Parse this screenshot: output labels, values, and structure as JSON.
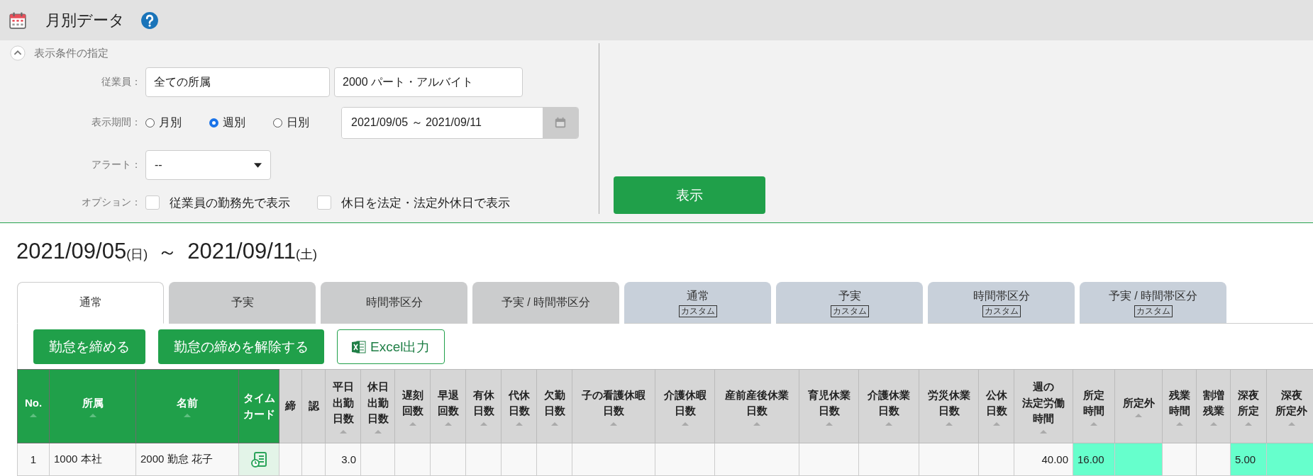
{
  "header": {
    "title": "月別データ"
  },
  "conditions": {
    "section_title": "表示条件の指定",
    "expanded": true,
    "employee": {
      "label": "従業員：",
      "department": "全ての所属",
      "employment_type": "2000 パート・アルバイト"
    },
    "period": {
      "label": "表示期間：",
      "options": [
        {
          "label": "月別",
          "selected": false
        },
        {
          "label": "週別",
          "selected": true
        },
        {
          "label": "日別",
          "selected": false
        }
      ],
      "range": "2021/09/05 ～ 2021/09/11"
    },
    "alert": {
      "label": "アラート：",
      "value": "--"
    },
    "options": {
      "label": "オプション：",
      "items": [
        {
          "label": "従業員の勤務先で表示",
          "checked": false
        },
        {
          "label": "休日を法定・法定外休日で表示",
          "checked": false
        }
      ]
    },
    "submit": "表示"
  },
  "heading": {
    "start": "2021/09/05",
    "start_day": "(日)",
    "separator": "～",
    "end": "2021/09/11",
    "end_day": "(土)"
  },
  "tabs": [
    {
      "label": "通常",
      "kind": "standard",
      "selected": true
    },
    {
      "label": "予実",
      "kind": "standard",
      "selected": false
    },
    {
      "label": "時間帯区分",
      "kind": "standard",
      "selected": false
    },
    {
      "label": "予実 / 時間帯区分",
      "kind": "standard",
      "selected": false
    },
    {
      "label": "通常",
      "kind": "custom",
      "badge": "カスタム",
      "selected": false
    },
    {
      "label": "予実",
      "kind": "custom",
      "badge": "カスタム",
      "selected": false
    },
    {
      "label": "時間帯区分",
      "kind": "custom",
      "badge": "カスタム",
      "selected": false
    },
    {
      "label": "予実 / 時間帯区分",
      "kind": "custom",
      "badge": "カスタム",
      "selected": false
    }
  ],
  "actions": [
    {
      "label": "勤怠を締める",
      "kind": "primary"
    },
    {
      "label": "勤怠の締めを解除する",
      "kind": "primary"
    },
    {
      "label": "Excel出力",
      "kind": "excel"
    }
  ],
  "table": {
    "columns": [
      {
        "lines": [
          "No."
        ],
        "fixed": true,
        "sortable": true
      },
      {
        "lines": [
          "所属"
        ],
        "fixed": true,
        "sortable": true
      },
      {
        "lines": [
          "名前"
        ],
        "fixed": true,
        "sortable": true
      },
      {
        "lines": [
          "タイム",
          "カード"
        ],
        "fixed": true,
        "sortable": false
      },
      {
        "lines": [
          "締"
        ],
        "fixed": false,
        "sortable": false
      },
      {
        "lines": [
          "認"
        ],
        "fixed": false,
        "sortable": false
      },
      {
        "lines": [
          "平日",
          "出勤",
          "日数"
        ],
        "fixed": false,
        "sortable": true
      },
      {
        "lines": [
          "休日",
          "出勤",
          "日数"
        ],
        "fixed": false,
        "sortable": true
      },
      {
        "lines": [
          "遅刻",
          "回数"
        ],
        "fixed": false,
        "sortable": true
      },
      {
        "lines": [
          "早退",
          "回数"
        ],
        "fixed": false,
        "sortable": true
      },
      {
        "lines": [
          "有休",
          "日数"
        ],
        "fixed": false,
        "sortable": true
      },
      {
        "lines": [
          "代休",
          "日数"
        ],
        "fixed": false,
        "sortable": true
      },
      {
        "lines": [
          "欠勤",
          "日数"
        ],
        "fixed": false,
        "sortable": true
      },
      {
        "lines": [
          "子の看護休暇",
          "日数"
        ],
        "fixed": false,
        "sortable": true
      },
      {
        "lines": [
          "介護休暇",
          "日数"
        ],
        "fixed": false,
        "sortable": true
      },
      {
        "lines": [
          "産前産後休業",
          "日数"
        ],
        "fixed": false,
        "sortable": true
      },
      {
        "lines": [
          "育児休業",
          "日数"
        ],
        "fixed": false,
        "sortable": true
      },
      {
        "lines": [
          "介護休業",
          "日数"
        ],
        "fixed": false,
        "sortable": true
      },
      {
        "lines": [
          "労災休業",
          "日数"
        ],
        "fixed": false,
        "sortable": true
      },
      {
        "lines": [
          "公休",
          "日数"
        ],
        "fixed": false,
        "sortable": true
      },
      {
        "lines": [
          "週の",
          "法定労働",
          "時間"
        ],
        "fixed": false,
        "sortable": true
      },
      {
        "lines": [
          "所定",
          "時間"
        ],
        "fixed": false,
        "sortable": true
      },
      {
        "lines": [
          "所定外"
        ],
        "fixed": false,
        "sortable": true
      },
      {
        "lines": [
          "残業",
          "時間"
        ],
        "fixed": false,
        "sortable": true
      },
      {
        "lines": [
          "割増",
          "残業"
        ],
        "fixed": false,
        "sortable": true
      },
      {
        "lines": [
          "深夜",
          "所定"
        ],
        "fixed": false,
        "sortable": true
      },
      {
        "lines": [
          "深夜",
          "所定外"
        ],
        "fixed": false,
        "sortable": true
      }
    ],
    "rows": [
      {
        "cells": [
          {
            "text": "1",
            "kind": "number",
            "highlighted": false
          },
          {
            "text": "1000 本社",
            "kind": "text",
            "highlighted": false
          },
          {
            "text": "2000 勤怠 花子",
            "kind": "text",
            "highlighted": false
          },
          {
            "kind": "timecard",
            "highlighted": false
          },
          {
            "kind": "empty",
            "highlighted": false
          },
          {
            "kind": "empty",
            "highlighted": false
          },
          {
            "text": "3.0",
            "kind": "number",
            "highlighted": false
          },
          {
            "kind": "empty",
            "highlighted": false
          },
          {
            "kind": "empty",
            "highlighted": false
          },
          {
            "kind": "empty",
            "highlighted": false
          },
          {
            "kind": "empty",
            "highlighted": false
          },
          {
            "kind": "empty",
            "highlighted": false
          },
          {
            "kind": "empty",
            "highlighted": false
          },
          {
            "kind": "empty",
            "highlighted": false
          },
          {
            "kind": "empty",
            "highlighted": false
          },
          {
            "kind": "empty",
            "highlighted": false
          },
          {
            "kind": "empty",
            "highlighted": false
          },
          {
            "kind": "empty",
            "highlighted": false
          },
          {
            "kind": "empty",
            "highlighted": false
          },
          {
            "kind": "empty",
            "highlighted": false
          },
          {
            "text": "40.00",
            "kind": "number",
            "highlighted": false
          },
          {
            "text": "16.00",
            "kind": "text",
            "highlighted": true
          },
          {
            "kind": "empty",
            "highlighted": true
          },
          {
            "kind": "empty",
            "highlighted": false
          },
          {
            "kind": "empty",
            "highlighted": false
          },
          {
            "text": "5.00",
            "kind": "text",
            "highlighted": true
          },
          {
            "kind": "empty",
            "highlighted": true
          }
        ]
      }
    ]
  }
}
